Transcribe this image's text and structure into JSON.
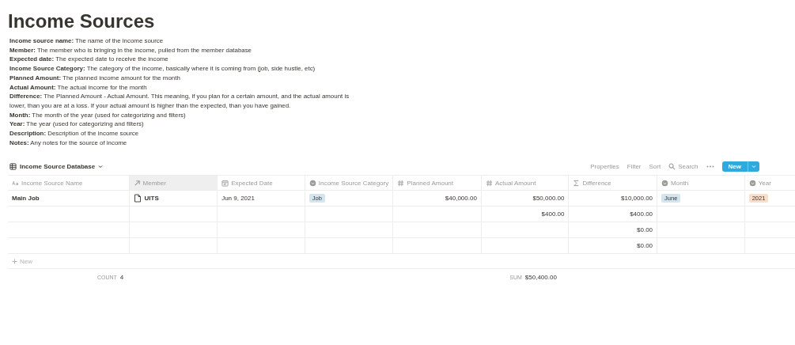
{
  "title": "Income Sources",
  "descriptions": [
    "**Income source name:** The name of the income source",
    "**Member:** The member who is bringing in the income, pulled from the member database",
    "**Expected date:** The expected date to receive the income",
    "**Income Source Category:** The category of the income, basically where it is coming from (job, side hustle, etc)",
    "**Planned Amount:** The planned income amount for the month",
    "**Actual Amount:** The actual income for the month",
    "**Difference:** The Planned Amount - Actual Amount. This meaning, if you plan for a certain amount, and the actual amount is lower, than you are at a loss. If your actual amount is higher than the expected, than you have gained.",
    "**Month:** The month of the year (used for categorizing and filters)",
    "**Year:** The year (used for categorizing and filters)",
    "**Description:** Description of the income source",
    "**Notes:** Any notes for the source of income"
  ],
  "database": {
    "name": "Income Source Database",
    "actions": [
      "Properties",
      "Filter",
      "Sort",
      "Search"
    ],
    "new_button": "New"
  },
  "columns": [
    {
      "label": "Income Source Name",
      "kind": "text",
      "selected": false
    },
    {
      "label": "Member",
      "kind": "relation",
      "selected": true
    },
    {
      "label": "Expected Date",
      "kind": "date",
      "selected": false
    },
    {
      "label": "Income Source Category",
      "kind": "select",
      "selected": false
    },
    {
      "label": "Planned Amount",
      "kind": "number",
      "selected": false
    },
    {
      "label": "Actual Amount",
      "kind": "number",
      "selected": false
    },
    {
      "label": "Difference",
      "kind": "formula",
      "selected": false
    },
    {
      "label": "Month",
      "kind": "select",
      "selected": false
    },
    {
      "label": "Year",
      "kind": "select",
      "selected": false
    }
  ],
  "rows": [
    [
      {
        "kind": "title",
        "text": "Main Job"
      },
      {
        "kind": "page",
        "text": "UITS"
      },
      {
        "kind": "text",
        "text": "Jun 9, 2021"
      },
      {
        "kind": "tag",
        "text": "Job",
        "color": "#d3e5ef"
      },
      {
        "kind": "number",
        "text": "$40,000.00"
      },
      {
        "kind": "number",
        "text": "$50,000.00"
      },
      {
        "kind": "number",
        "text": "$10,000.00"
      },
      {
        "kind": "tag",
        "text": "June",
        "color": "#d3e5ef"
      },
      {
        "kind": "tag",
        "text": "2021",
        "color": "#fadec9"
      }
    ],
    [
      {
        "kind": "empty"
      },
      {
        "kind": "empty"
      },
      {
        "kind": "empty"
      },
      {
        "kind": "empty"
      },
      {
        "kind": "empty"
      },
      {
        "kind": "number",
        "text": "$400.00"
      },
      {
        "kind": "number",
        "text": "$400.00"
      },
      {
        "kind": "empty"
      },
      {
        "kind": "empty"
      }
    ],
    [
      {
        "kind": "empty"
      },
      {
        "kind": "empty"
      },
      {
        "kind": "empty"
      },
      {
        "kind": "empty"
      },
      {
        "kind": "empty"
      },
      {
        "kind": "empty"
      },
      {
        "kind": "number",
        "text": "$0.00"
      },
      {
        "kind": "empty"
      },
      {
        "kind": "empty"
      }
    ],
    [
      {
        "kind": "empty"
      },
      {
        "kind": "empty"
      },
      {
        "kind": "empty"
      },
      {
        "kind": "empty"
      },
      {
        "kind": "empty"
      },
      {
        "kind": "empty"
      },
      {
        "kind": "number",
        "text": "$0.00"
      },
      {
        "kind": "empty"
      },
      {
        "kind": "empty"
      }
    ]
  ],
  "new_row": "New",
  "footer": [
    {
      "kind": "calc",
      "label": "COUNT",
      "value": "4"
    },
    {
      "kind": "empty"
    },
    {
      "kind": "empty"
    },
    {
      "kind": "empty"
    },
    {
      "kind": "empty"
    },
    {
      "kind": "calc",
      "label": "SUM",
      "value": "$50,400.00"
    },
    {
      "kind": "empty"
    },
    {
      "kind": "empty"
    },
    {
      "kind": "empty"
    }
  ]
}
